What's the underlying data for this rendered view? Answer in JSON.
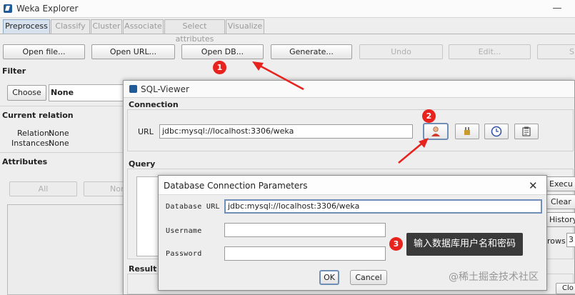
{
  "window": {
    "title": "Weka Explorer",
    "minimize": "—"
  },
  "tabs": [
    "Preprocess",
    "Classify",
    "Cluster",
    "Associate",
    "Select attributes",
    "Visualize"
  ],
  "toolbar": {
    "open_file": "Open file...",
    "open_url": "Open URL...",
    "open_db": "Open DB...",
    "generate": "Generate...",
    "undo": "Undo",
    "edit": "Edit...",
    "save": "S"
  },
  "filter": {
    "heading": "Filter",
    "choose": "Choose",
    "value": "None"
  },
  "current_relation": {
    "heading": "Current relation",
    "relation_label": "Relation:",
    "relation_value": "None",
    "instances_label": "Instances:",
    "instances_value": "None"
  },
  "attributes": {
    "heading": "Attributes",
    "all": "All",
    "none": "None"
  },
  "sql_viewer": {
    "title": "SQL-Viewer",
    "connection_heading": "Connection",
    "url_label": "URL",
    "url_value": "jdbc:mysql://localhost:3306/weka",
    "query_heading": "Query",
    "execute": "Execu",
    "clear": "Clear",
    "history": "History...",
    "rows_label": "rows",
    "rows_value": "3",
    "result_heading": "Result",
    "close": "Clo"
  },
  "dialog": {
    "title": "Database Connection Parameters",
    "close": "✕",
    "db_url_label": "Database URL",
    "db_url_value": "jdbc:mysql://localhost:3306/weka",
    "username_label": "Username",
    "password_label": "Password",
    "ok": "OK",
    "cancel": "Cancel"
  },
  "annotations": {
    "step1": "1",
    "step2": "2",
    "step3": "3",
    "tooltip": "输入数据库用户名和密码",
    "watermark": "@稀土掘金技术社区",
    "color": "#e8231e"
  }
}
